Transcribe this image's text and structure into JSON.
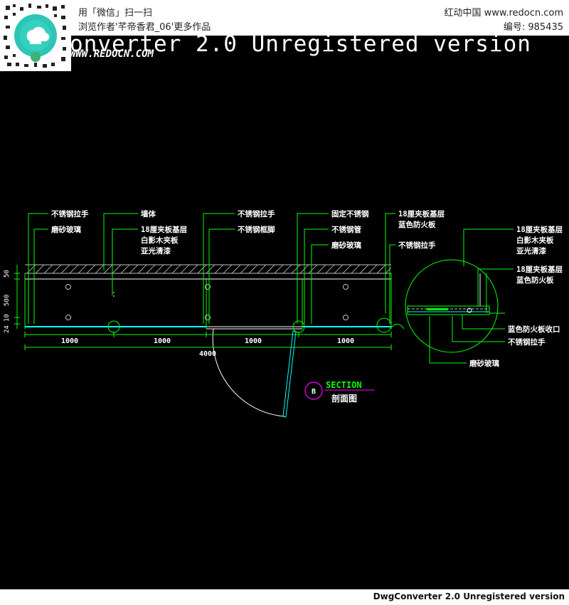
{
  "header": {
    "scan_line": "用「微信」扫一扫",
    "author_line": "浏览作者'芊帝香君_06'更多作品",
    "site_line": "红动中国 www.redocn.com",
    "id_line": "编号: 985435"
  },
  "watermark": {
    "top_banner": "onverter 2.0 Unregistered version",
    "redocn": "WWW.REDOCN.COM"
  },
  "footer": {
    "unregistered": "DwgConverter 2.0 Unregistered version"
  },
  "colors": {
    "line_green": "#00ff00",
    "line_cyan": "#00ffff",
    "white": "#ffffff",
    "magenta": "#ff00ff",
    "hatch": "#cccccc"
  },
  "drawing": {
    "labels": {
      "top1": "不锈钢拉手",
      "top1b": "磨砂玻璃",
      "top2": "墙体",
      "top2b_1": "18厘夹板基层",
      "top2b_2": "白影木夹板",
      "top2b_3": "亚光清漆",
      "top3": "不锈钢拉手",
      "top3b": "不锈钢框脚",
      "top4": "固定不锈钢",
      "top4b": "不锈钢管",
      "top4c": "磨砂玻璃",
      "top5_1": "18厘夹板基层",
      "top5_2": "蓝色防火板",
      "top5b": "不锈钢拉手",
      "detail1_1": "18厘夹板基层",
      "detail1_2": "白影木夹板",
      "detail1_3": "亚光清漆",
      "detail2_1": "18厘夹板基层",
      "detail2_2": "蓝色防火板",
      "detail3": "蓝色防火板收口",
      "detail4": "不锈钢拉手",
      "detail5": "磨砂玻璃"
    },
    "dims": {
      "d1": "1000",
      "d2": "1000",
      "d3": "1000",
      "d4": "1000",
      "total": "4000",
      "v1": "50",
      "v2": "500",
      "v3": "10",
      "v4": "24"
    },
    "section": {
      "marker": "B",
      "title": "SECTION",
      "subtitle": "剖面图"
    }
  }
}
